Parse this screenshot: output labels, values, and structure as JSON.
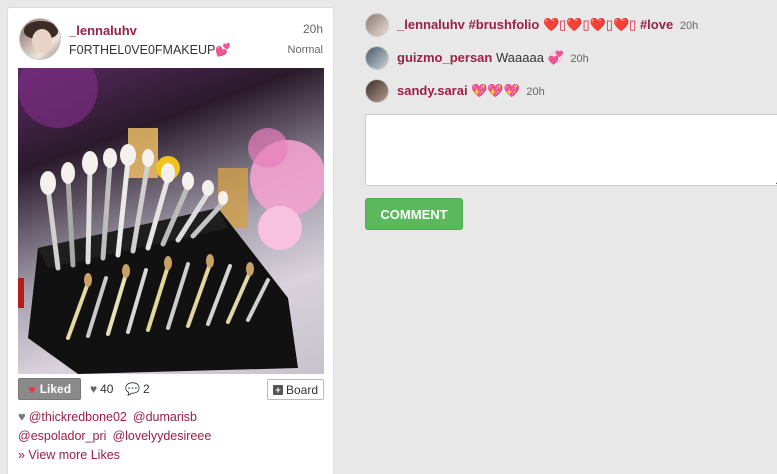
{
  "post": {
    "username": "_lennaluhv",
    "time": "20h",
    "caption": "F0RTHEL0VE0FMAKEUP",
    "caption_emoji": "💕",
    "filter": "Normal",
    "photo_icon": "makeup-brushes-photo",
    "actions": {
      "liked_label": "Liked",
      "likes_count": "40",
      "comments_count": "2",
      "board_label": "Board"
    },
    "likers": [
      "@thickredbone02",
      "@dumarisb",
      "@espolador_pri",
      "@lovelyydesireee"
    ],
    "view_more": "» View more Likes"
  },
  "comments": [
    {
      "user": "_lennaluhv",
      "tag1": "#brushfolio",
      "hearts": "❤️▯❤️▯❤️▯❤️▯",
      "tag2": "#love",
      "time": "20h"
    },
    {
      "user": "guizmo_persan",
      "text": "Waaaaa",
      "emoji": "💞",
      "time": "20h"
    },
    {
      "user": "sandy.sarai",
      "emoji": "💖💖💖",
      "time": "20h"
    }
  ],
  "comment_form": {
    "placeholder": "",
    "submit_label": "COMMENT"
  },
  "colors": {
    "accent": "#9b1f46",
    "button_green": "#5cb85c",
    "liked_gray": "#8a8a8a",
    "background": "#e8e8e8"
  }
}
